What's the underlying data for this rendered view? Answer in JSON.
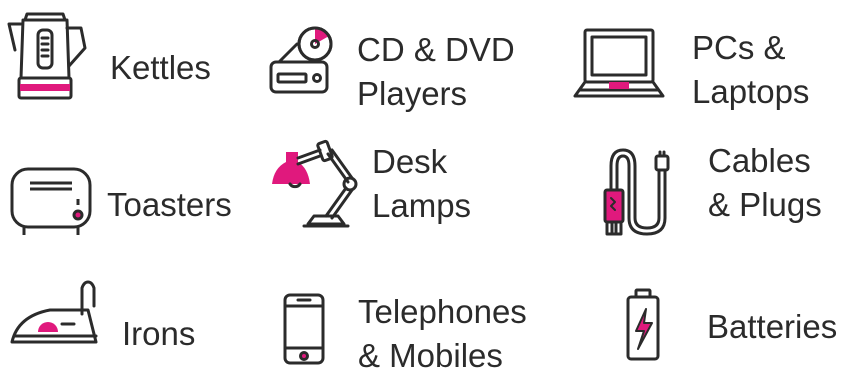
{
  "items": [
    {
      "icon": "kettle-icon",
      "lines": [
        "Kettles"
      ]
    },
    {
      "icon": "cd-dvd-player-icon",
      "lines": [
        "CD & DVD",
        "Players"
      ]
    },
    {
      "icon": "laptop-icon",
      "lines": [
        "PCs &",
        "Laptops"
      ]
    },
    {
      "icon": "toaster-icon",
      "lines": [
        "Toasters"
      ]
    },
    {
      "icon": "desk-lamp-icon",
      "lines": [
        "Desk",
        "Lamps"
      ]
    },
    {
      "icon": "cable-plug-icon",
      "lines": [
        "Cables",
        "& Plugs"
      ]
    },
    {
      "icon": "iron-icon",
      "lines": [
        "Irons"
      ]
    },
    {
      "icon": "mobile-phone-icon",
      "lines": [
        "Telephones",
        "& Mobiles"
      ]
    },
    {
      "icon": "battery-icon",
      "lines": [
        "Batteries"
      ]
    }
  ],
  "colors": {
    "accent": "#e0197d",
    "stroke": "#2b2b2b",
    "background": "#ffffff"
  }
}
